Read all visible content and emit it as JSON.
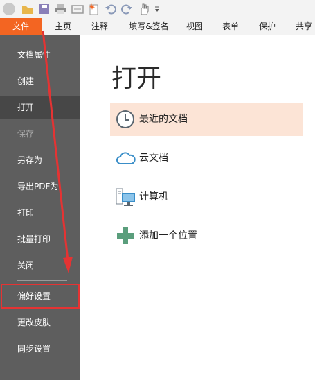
{
  "quick_access": {
    "icons": [
      "app-icon",
      "open-folder-icon",
      "save-icon",
      "print-icon",
      "scan-icon",
      "new-document-icon",
      "undo-icon",
      "redo-icon",
      "hand-tool-icon",
      "customize-dropdown-icon"
    ]
  },
  "ribbon": {
    "tabs": [
      {
        "label": "文件"
      },
      {
        "label": "主页"
      },
      {
        "label": "注释"
      },
      {
        "label": "填写&签名"
      },
      {
        "label": "视图"
      },
      {
        "label": "表单"
      },
      {
        "label": "保护"
      },
      {
        "label": "共享"
      }
    ]
  },
  "menu": {
    "items": [
      {
        "label": "文档属性"
      },
      {
        "label": "创建"
      },
      {
        "label": "打开"
      },
      {
        "label": "保存"
      },
      {
        "label": "另存为"
      },
      {
        "label": "导出PDF为"
      },
      {
        "label": "打印"
      },
      {
        "label": "批量打印"
      },
      {
        "label": "关闭"
      },
      {
        "label": "偏好设置"
      },
      {
        "label": "更改皮肤"
      },
      {
        "label": "同步设置"
      }
    ],
    "active": "打开",
    "disabled": "保存",
    "highlighted": "偏好设置"
  },
  "main": {
    "title": "打开",
    "locations": [
      {
        "label": "最近的文档",
        "icon": "clock-icon"
      },
      {
        "label": "云文档",
        "icon": "cloud-icon"
      },
      {
        "label": "计算机",
        "icon": "computer-icon"
      },
      {
        "label": "添加一个位置",
        "icon": "plus-icon"
      }
    ]
  },
  "colors": {
    "file_tab": "#f36522",
    "menu_bg": "#5e5e5e",
    "menu_active": "#474747",
    "selected_row": "#fce4d6",
    "annotation_red": "#e53333",
    "accent_blue": "#3a8ec8",
    "plus_green": "#5a9e7c"
  }
}
